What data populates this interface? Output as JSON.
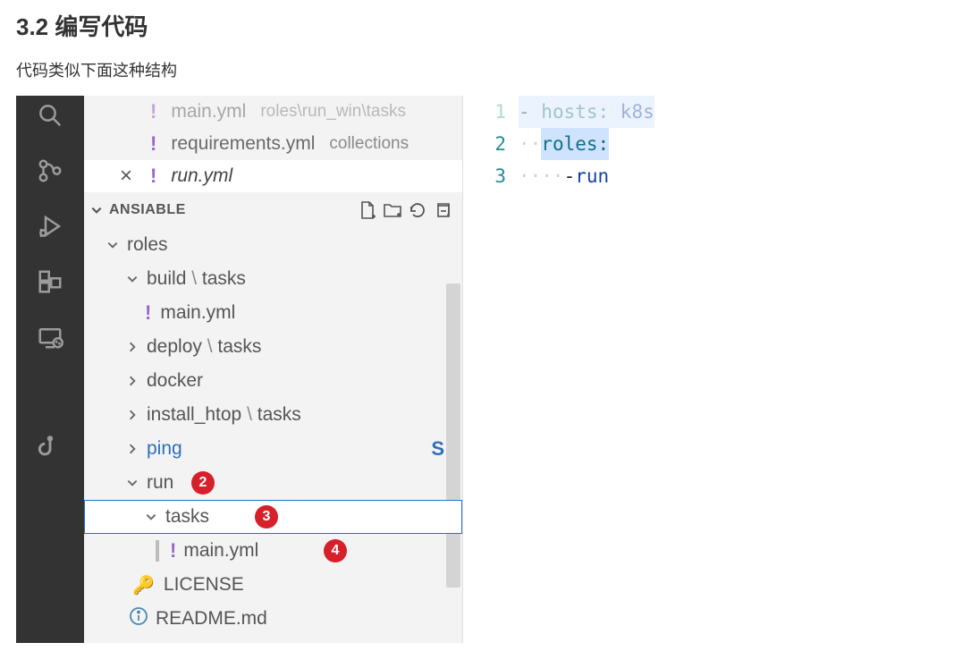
{
  "heading": "3.2 编写代码",
  "subtext": "代码类似下面这种结构",
  "tabs": {
    "t0": {
      "name": "main.yml",
      "hint": "roles\\run_win\\tasks"
    },
    "t1": {
      "name": "requirements.yml",
      "hint": "collections"
    },
    "t2": {
      "name": "run.yml"
    }
  },
  "section_title": "ANSIABLE",
  "tree": {
    "roles": "roles",
    "build": "build",
    "tasks_sep": "tasks",
    "main_yml": "main.yml",
    "deploy": "deploy",
    "docker": "docker",
    "install_htop": "install_htop",
    "ping": "ping",
    "ping_badge": "S",
    "run": "run",
    "tasks": "tasks",
    "main2": "main.yml",
    "license": "LICENSE",
    "readme": "README.md"
  },
  "bubbles": {
    "b2": "2",
    "b3": "3",
    "b4": "4"
  },
  "gutter": {
    "l1": "1",
    "l2": "2",
    "l3": "3"
  },
  "code": {
    "l1_a": "- ",
    "l1_b": "hosts:",
    "l1_c": " k8s",
    "l2_a": "roles:",
    "l3_a": "- ",
    "l3_b": "run"
  }
}
